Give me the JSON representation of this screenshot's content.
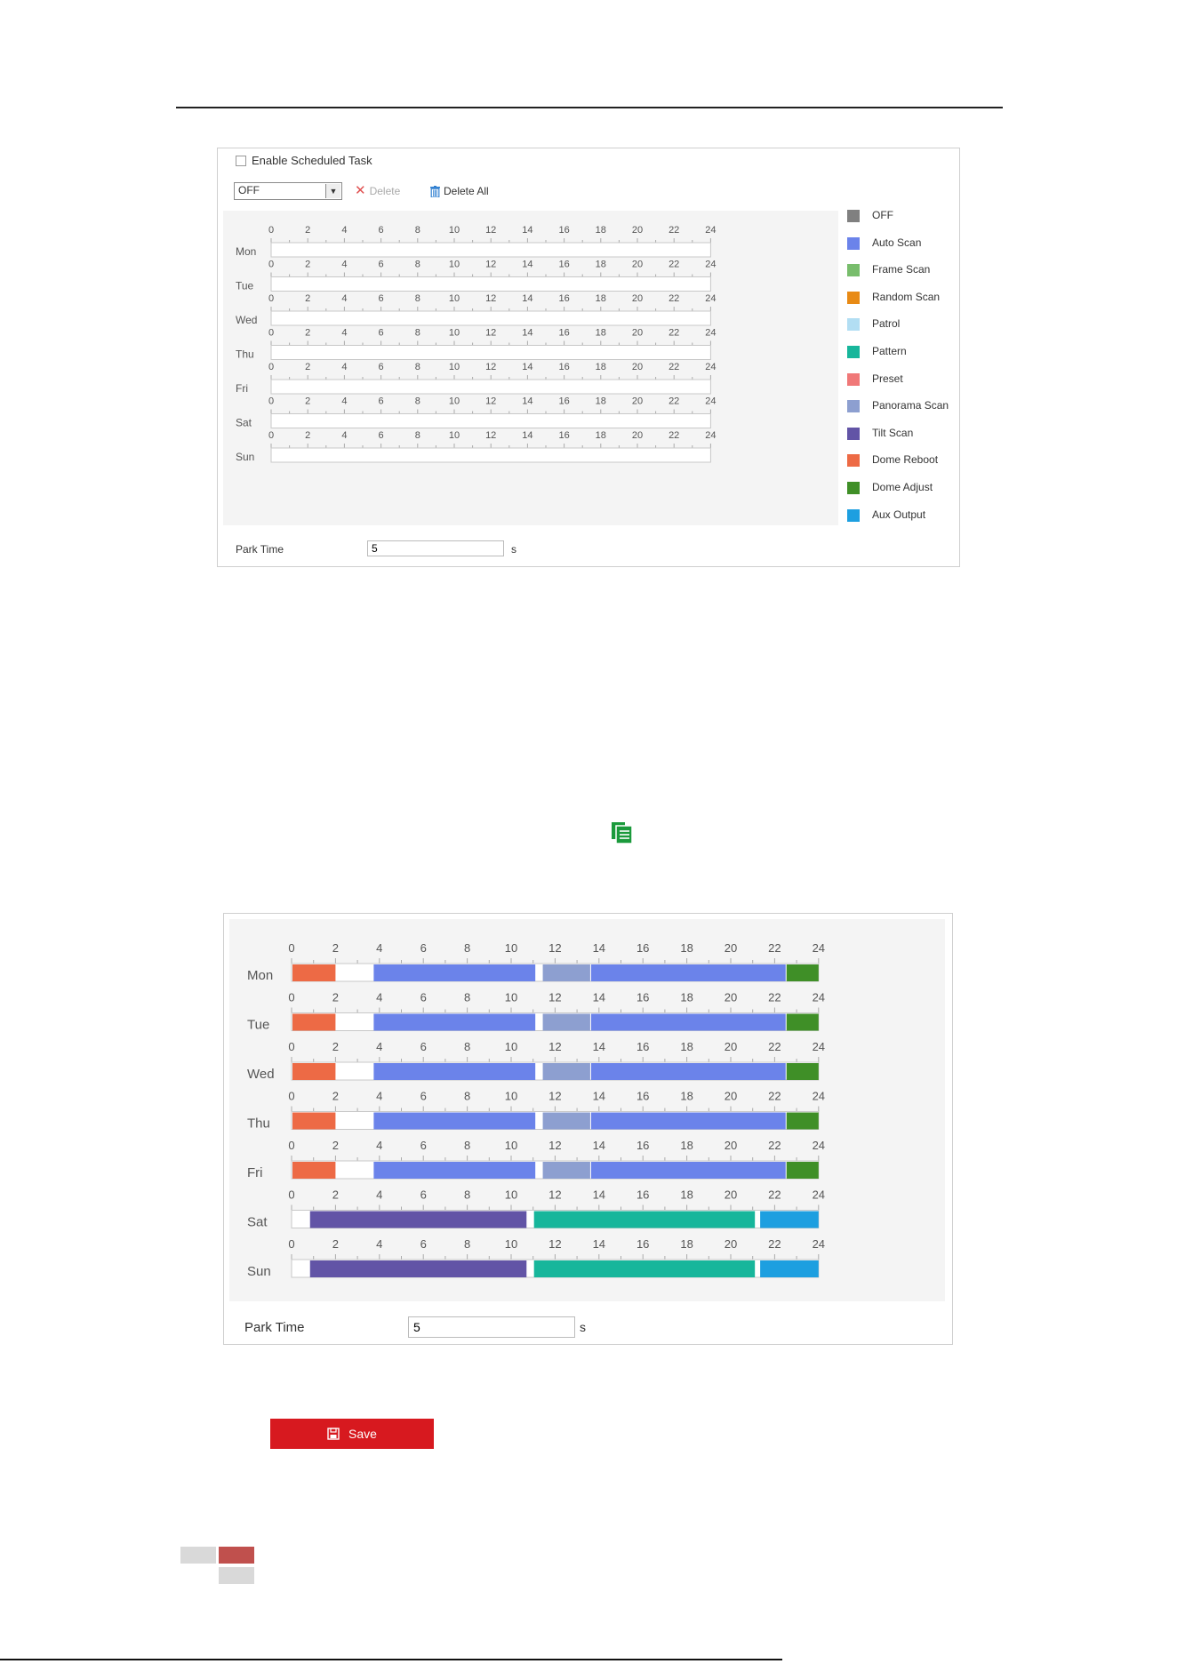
{
  "form_top": {
    "enable_label": "Enable Scheduled Task",
    "mode_select_value": "OFF",
    "delete_label": "Delete",
    "delete_all_label": "Delete All",
    "park_time_label": "Park Time",
    "park_time_value": "5",
    "park_time_unit": "s"
  },
  "hours": [
    "0",
    "2",
    "4",
    "6",
    "8",
    "10",
    "12",
    "14",
    "16",
    "18",
    "20",
    "22",
    "24"
  ],
  "days": [
    "Mon",
    "Tue",
    "Wed",
    "Thu",
    "Fri",
    "Sat",
    "Sun"
  ],
  "legend": [
    {
      "label": "OFF",
      "color": "#808080"
    },
    {
      "label": "Auto Scan",
      "color": "#6b83ea"
    },
    {
      "label": "Frame Scan",
      "color": "#78bd6c"
    },
    {
      "label": "Random Scan",
      "color": "#e88a15"
    },
    {
      "label": "Patrol",
      "color": "#b2def3"
    },
    {
      "label": "Pattern",
      "color": "#17b69b"
    },
    {
      "label": "Preset",
      "color": "#f07878"
    },
    {
      "label": "Panorama Scan",
      "color": "#8d9fd0"
    },
    {
      "label": "Tilt Scan",
      "color": "#6254a6"
    },
    {
      "label": "Dome Reboot",
      "color": "#ed6a45"
    },
    {
      "label": "Dome Adjust",
      "color": "#3f8f27"
    },
    {
      "label": "Aux Output",
      "color": "#1d9fe0"
    }
  ],
  "schedule": [
    {
      "day": "Mon",
      "segments": [
        {
          "task": "Dome Reboot",
          "start": 0,
          "end": 2
        },
        {
          "task": "Auto Scan",
          "start": 3.7,
          "end": 11.1
        },
        {
          "task": "Panorama Scan",
          "start": 11.4,
          "end": 13.6
        },
        {
          "task": "Auto Scan",
          "start": 13.6,
          "end": 22.5
        },
        {
          "task": "Dome Adjust",
          "start": 22.5,
          "end": 24
        }
      ]
    },
    {
      "day": "Tue",
      "segments": [
        {
          "task": "Dome Reboot",
          "start": 0,
          "end": 2
        },
        {
          "task": "Auto Scan",
          "start": 3.7,
          "end": 11.1
        },
        {
          "task": "Panorama Scan",
          "start": 11.4,
          "end": 13.6
        },
        {
          "task": "Auto Scan",
          "start": 13.6,
          "end": 22.5
        },
        {
          "task": "Dome Adjust",
          "start": 22.5,
          "end": 24
        }
      ]
    },
    {
      "day": "Wed",
      "segments": [
        {
          "task": "Dome Reboot",
          "start": 0,
          "end": 2
        },
        {
          "task": "Auto Scan",
          "start": 3.7,
          "end": 11.1
        },
        {
          "task": "Panorama Scan",
          "start": 11.4,
          "end": 13.6
        },
        {
          "task": "Auto Scan",
          "start": 13.6,
          "end": 22.5
        },
        {
          "task": "Dome Adjust",
          "start": 22.5,
          "end": 24
        }
      ]
    },
    {
      "day": "Thu",
      "segments": [
        {
          "task": "Dome Reboot",
          "start": 0,
          "end": 2
        },
        {
          "task": "Auto Scan",
          "start": 3.7,
          "end": 11.1
        },
        {
          "task": "Panorama Scan",
          "start": 11.4,
          "end": 13.6
        },
        {
          "task": "Auto Scan",
          "start": 13.6,
          "end": 22.5
        },
        {
          "task": "Dome Adjust",
          "start": 22.5,
          "end": 24
        }
      ]
    },
    {
      "day": "Fri",
      "segments": [
        {
          "task": "Dome Reboot",
          "start": 0,
          "end": 2
        },
        {
          "task": "Auto Scan",
          "start": 3.7,
          "end": 11.1
        },
        {
          "task": "Panorama Scan",
          "start": 11.4,
          "end": 13.6
        },
        {
          "task": "Auto Scan",
          "start": 13.6,
          "end": 22.5
        },
        {
          "task": "Dome Adjust",
          "start": 22.5,
          "end": 24
        }
      ]
    },
    {
      "day": "Sat",
      "segments": [
        {
          "task": "Tilt Scan",
          "start": 0.8,
          "end": 10.7
        },
        {
          "task": "Pattern",
          "start": 11,
          "end": 21.1
        },
        {
          "task": "Aux Output",
          "start": 21.3,
          "end": 24
        }
      ]
    },
    {
      "day": "Sun",
      "segments": [
        {
          "task": "Tilt Scan",
          "start": 0.8,
          "end": 10.7
        },
        {
          "task": "Pattern",
          "start": 11,
          "end": 21.1
        },
        {
          "task": "Aux Output",
          "start": 21.3,
          "end": 24
        }
      ]
    }
  ],
  "form_bottom": {
    "park_time_label": "Park Time",
    "park_time_value": "5",
    "park_time_unit": "s"
  },
  "save_label": "Save",
  "colors": {
    "save_button": "#d7191f",
    "copy_icon": "#1b9a3c",
    "footer_red": "#c0504d",
    "footer_grey": "#d9d9d9"
  }
}
